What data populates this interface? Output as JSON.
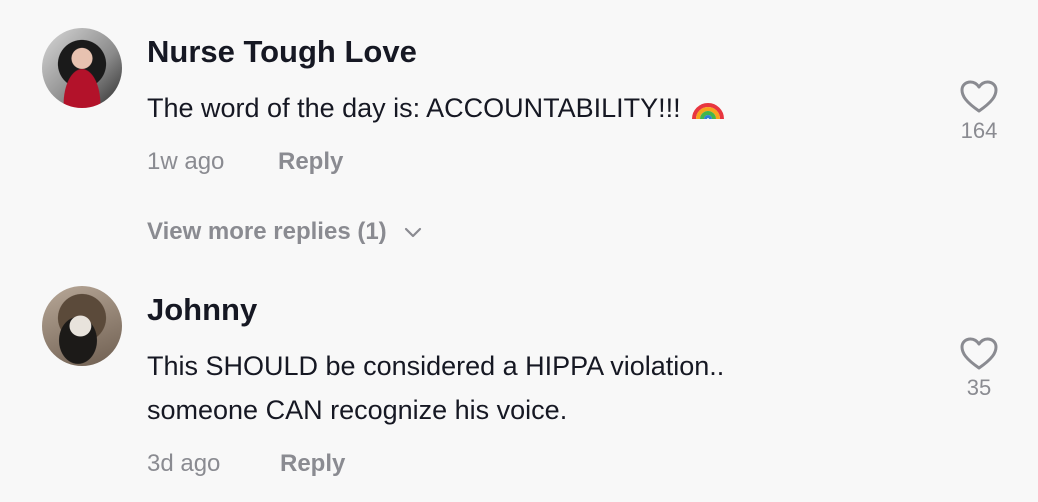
{
  "comments": [
    {
      "name": "Nurse Tough Love",
      "text_lines": [
        "The word of the day is: ACCOUNTABILITY!!!"
      ],
      "emoji": "rainbow-emoji",
      "time": "1w ago",
      "reply_label": "Reply",
      "likes": "164",
      "avatar_icon": "avatar-nurse-tough-love"
    },
    {
      "name": "Johnny",
      "text_lines": [
        "This SHOULD be considered a HIPPA violation..",
        "someone CAN recognize his voice."
      ],
      "time": "3d ago",
      "reply_label": "Reply",
      "likes": "35",
      "avatar_icon": "avatar-johnny"
    }
  ],
  "view_more_replies": "View more replies (1)",
  "colors": {
    "primary_text": "#161823",
    "secondary_text": "#8a8b91",
    "background": "#f8f8f8"
  }
}
